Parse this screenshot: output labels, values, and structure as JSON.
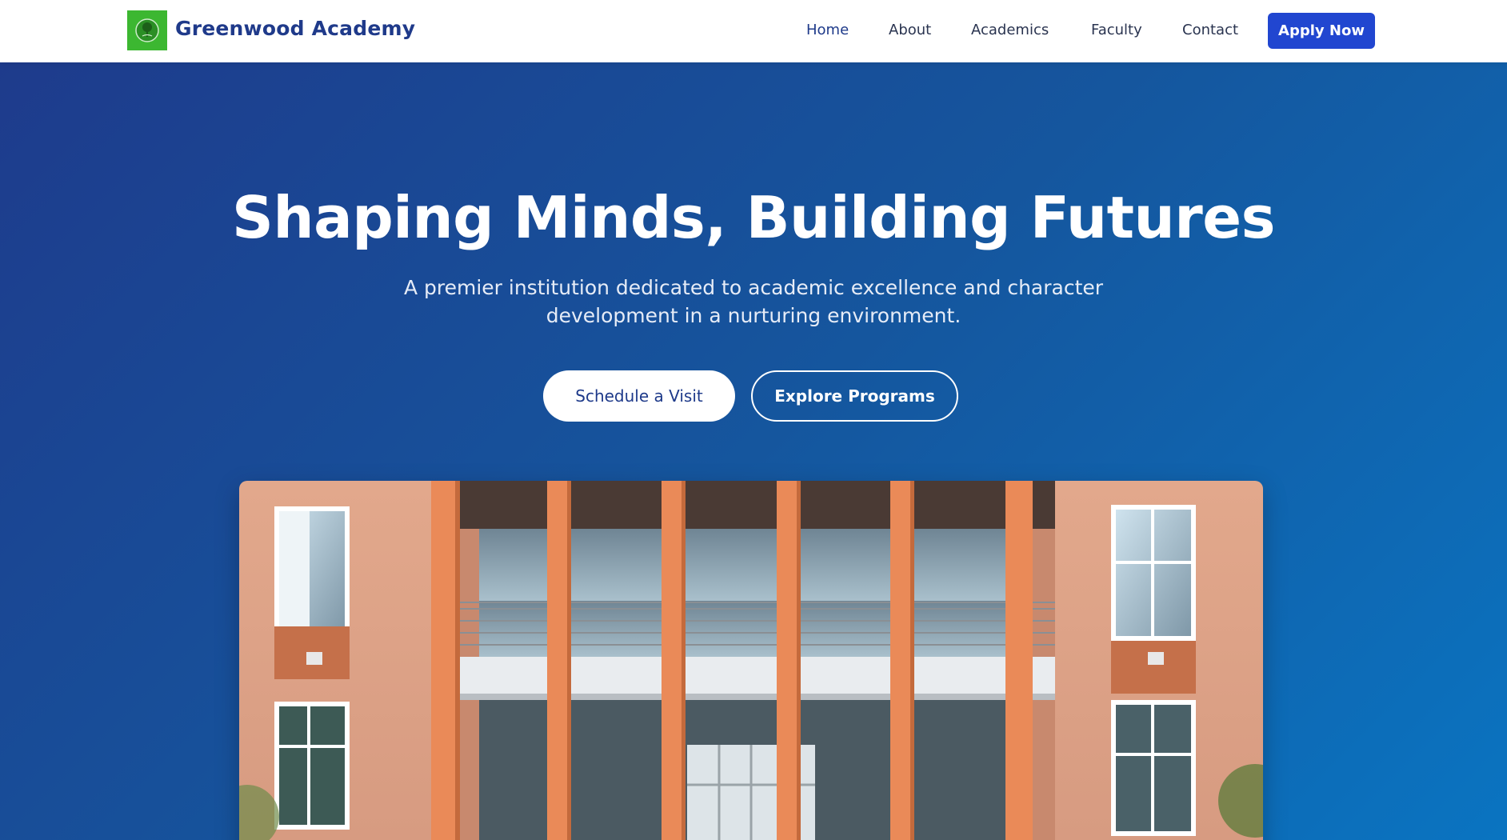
{
  "header": {
    "brand": "Greenwood Academy",
    "logo_icon": "tree-icon",
    "nav": [
      {
        "label": "Home"
      },
      {
        "label": "About"
      },
      {
        "label": "Academics"
      },
      {
        "label": "Faculty"
      },
      {
        "label": "Contact"
      }
    ],
    "cta_label": "Apply Now"
  },
  "hero": {
    "title": "Shaping Minds, Building Futures",
    "subtitle": "A premier institution dedicated to academic excellence and character development in a nurturing environment.",
    "primary_button": "Schedule a Visit",
    "secondary_button": "Explore Programs"
  },
  "colors": {
    "brand": "#1f3a8a",
    "accent": "#2146d0",
    "logo_green": "#3cb731",
    "hero_gradient_start": "#1e3b8c",
    "hero_gradient_end": "#0a74c1"
  }
}
